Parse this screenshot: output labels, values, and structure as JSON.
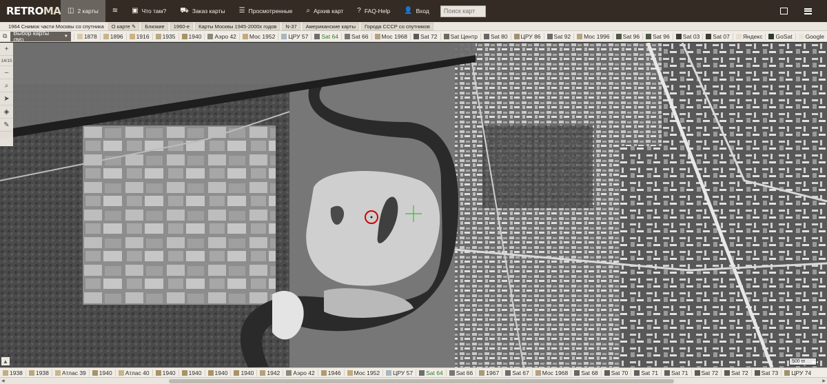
{
  "nav": {
    "logo_a": "RETRO",
    "logo_b": "MAP",
    "items": [
      {
        "label": "2 карты",
        "icon": "split-screen-icon"
      },
      {
        "label": "",
        "icon": "layers-icon"
      },
      {
        "label": "Что там?",
        "icon": "picture-icon"
      },
      {
        "label": "Заказ карты",
        "icon": "cart-icon"
      },
      {
        "label": "Просмотренные",
        "icon": "list-icon"
      },
      {
        "label": "Архив карт",
        "icon": "search-icon"
      },
      {
        "label": "FAQ-Help",
        "icon": "question-icon"
      },
      {
        "label": "Вход",
        "icon": "user-icon"
      }
    ],
    "search_placeholder": "Поиск карт"
  },
  "subbar": {
    "title": "1964 Снимок части Москвы со спутника",
    "links": [
      "О карте",
      "Близкие",
      "1960-е",
      "Карты Москвы 1945-2000х годов",
      "N-37",
      "Американские карты",
      "Города СССР со спутников"
    ]
  },
  "layerbar": {
    "select_label": "Выбор карты (86)",
    "layers": [
      {
        "label": "1878",
        "thumb": "#d8c9a6"
      },
      {
        "label": "1896",
        "thumb": "#c9b58c"
      },
      {
        "label": "1916",
        "thumb": "#cdb27d"
      },
      {
        "label": "1935",
        "thumb": "#b8a883"
      },
      {
        "label": "1940",
        "thumb": "#a89268"
      },
      {
        "label": "Аэро 42",
        "thumb": "#8a8a7a"
      },
      {
        "label": "Мос 1952",
        "thumb": "#c3aa7a"
      },
      {
        "label": "ЦРУ 57",
        "thumb": "#a8b6c0"
      },
      {
        "label": "Sat 64",
        "thumb": "#6e6e6e",
        "active": true
      },
      {
        "label": "Sat 66",
        "thumb": "#777"
      },
      {
        "label": "Мос 1968",
        "thumb": "#b4a082"
      },
      {
        "label": "Sat 72",
        "thumb": "#5a5a5a"
      },
      {
        "label": "Sat Центр",
        "thumb": "#6b6b5b"
      },
      {
        "label": "Sat 80",
        "thumb": "#666"
      },
      {
        "label": "ЦРУ 86",
        "thumb": "#a09070"
      },
      {
        "label": "Sat 92",
        "thumb": "#6b6b6b"
      },
      {
        "label": "Мос 1996",
        "thumb": "#b7a37f"
      },
      {
        "label": "Sat 96",
        "thumb": "#4f5a46"
      },
      {
        "label": "Sat 96",
        "thumb": "#4f5a46"
      },
      {
        "label": "Sat 03",
        "thumb": "#3b3b33"
      },
      {
        "label": "Sat 07",
        "thumb": "#3f3a32"
      },
      {
        "label": "Яндекс",
        "thumb": "#e6dfcf"
      },
      {
        "label": "GoSat",
        "thumb": "#2f3a2a"
      },
      {
        "label": "Google",
        "thumb": "#e9e4d6"
      }
    ]
  },
  "left_tools": {
    "zoom_in": "+",
    "zoom_level": "14/15",
    "zoom_out": "–"
  },
  "bottombar": {
    "layers": [
      {
        "label": "1938",
        "thumb": "#c3ae82"
      },
      {
        "label": "1938",
        "thumb": "#bda777"
      },
      {
        "label": "Атлас 39",
        "thumb": "#c8b58d"
      },
      {
        "label": "1940",
        "thumb": "#a89268"
      },
      {
        "label": "Атлас 40",
        "thumb": "#c9b389"
      },
      {
        "label": "1940",
        "thumb": "#a89268"
      },
      {
        "label": "1940",
        "thumb": "#a89268"
      },
      {
        "label": "1940",
        "thumb": "#a89268"
      },
      {
        "label": "1940",
        "thumb": "#a89268"
      },
      {
        "label": "1942",
        "thumb": "#b4a17c"
      },
      {
        "label": "Аэро 42",
        "thumb": "#8a8a7a"
      },
      {
        "label": "1946",
        "thumb": "#b09a70"
      },
      {
        "label": "Мос 1952",
        "thumb": "#c3aa7a"
      },
      {
        "label": "ЦРУ 57",
        "thumb": "#a8b6c0"
      },
      {
        "label": "Sat 64",
        "thumb": "#6e6e6e",
        "active": true
      },
      {
        "label": "Sat 66",
        "thumb": "#777"
      },
      {
        "label": "1967",
        "thumb": "#a9987a"
      },
      {
        "label": "Sat 67",
        "thumb": "#6d6d6d"
      },
      {
        "label": "Мос 1968",
        "thumb": "#b4a082"
      },
      {
        "label": "Sat 68",
        "thumb": "#666"
      },
      {
        "label": "Sat 70",
        "thumb": "#5d5d5d"
      },
      {
        "label": "Sat 71",
        "thumb": "#606060"
      },
      {
        "label": "Sat 71",
        "thumb": "#606060"
      },
      {
        "label": "Sat 72",
        "thumb": "#5a5a5a"
      },
      {
        "label": "Sat 72",
        "thumb": "#5a5a5a"
      },
      {
        "label": "Sat 73",
        "thumb": "#595959"
      },
      {
        "label": "ЦРУ 74",
        "thumb": "#a09070"
      }
    ]
  },
  "scale_label": "500 m",
  "colors": {
    "topbar": "#332b24",
    "active_tab": "#6b655f",
    "marker_circle": "#d40000",
    "center_cross": "#2fc42f"
  }
}
